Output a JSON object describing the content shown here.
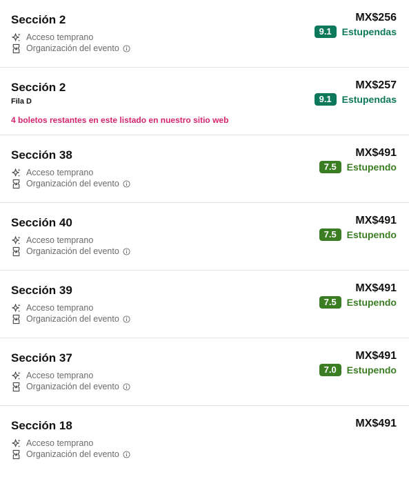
{
  "colors": {
    "rating_teal": "#0c7a5a",
    "rating_green": "#3b7d23",
    "remaining_pink": "#d6246e",
    "feature_gray": "#6a6a6a"
  },
  "features": {
    "early_access_label": "Acceso temprano",
    "early_access_icon": "sparkle-icon",
    "event_org_label": "Organización del evento",
    "event_org_icon": "ticket-icon",
    "info_icon": "info-icon"
  },
  "listings": [
    {
      "section": "Sección 2",
      "price": "MX$256",
      "score": "9.1",
      "score_label": "Estupendas",
      "score_color": "#0c7a5a"
    },
    {
      "section": "Sección 2",
      "row": "Fila D",
      "remaining": "4 boletos restantes en este listado en nuestro sitio web",
      "price": "MX$257",
      "score": "9.1",
      "score_label": "Estupendas",
      "score_color": "#0c7a5a"
    },
    {
      "section": "Sección 38",
      "price": "MX$491",
      "score": "7.5",
      "score_label": "Estupendo",
      "score_color": "#3b7d23"
    },
    {
      "section": "Sección 40",
      "price": "MX$491",
      "score": "7.5",
      "score_label": "Estupendo",
      "score_color": "#3b7d23"
    },
    {
      "section": "Sección 39",
      "price": "MX$491",
      "score": "7.5",
      "score_label": "Estupendo",
      "score_color": "#3b7d23"
    },
    {
      "section": "Sección 37",
      "price": "MX$491",
      "score": "7.0",
      "score_label": "Estupendo",
      "score_color": "#3b7d23"
    },
    {
      "section": "Sección 18",
      "price": "MX$491"
    }
  ]
}
